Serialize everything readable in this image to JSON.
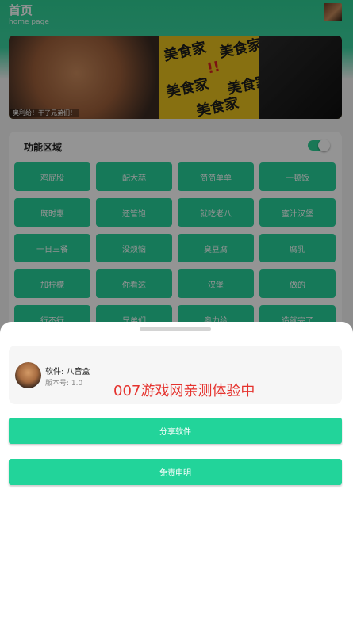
{
  "header": {
    "title": "首页",
    "subtitle": "home page"
  },
  "banner": {
    "words": [
      "美食家",
      "美食家",
      "美食家",
      "美食家",
      "美食家",
      "!!"
    ],
    "caption": "奥利给！干了兄弟们！"
  },
  "functions": {
    "title": "功能区域",
    "toggle_on": true,
    "buttons": [
      "鸡屁股",
      "配大蒜",
      "简简单单",
      "一顿饭",
      "既时惠",
      "还管饱",
      "就吃老八",
      "蜜汁汉堡",
      "一日三餐",
      "没烦恼",
      "臭豆腐",
      "腐乳",
      "加柠檬",
      "你看这",
      "汉堡",
      "做的",
      "行不行",
      "兄弟们",
      "奥力给",
      "造就完了"
    ]
  },
  "sheet": {
    "app_name": "软件: 八音盒",
    "app_version": "版本号: 1.0",
    "watermark": "007游戏网亲测体验中",
    "share_label": "分享软件",
    "disclaimer_label": "免责申明"
  },
  "colors": {
    "accent": "#22d49a",
    "watermark": "#e5322d"
  }
}
